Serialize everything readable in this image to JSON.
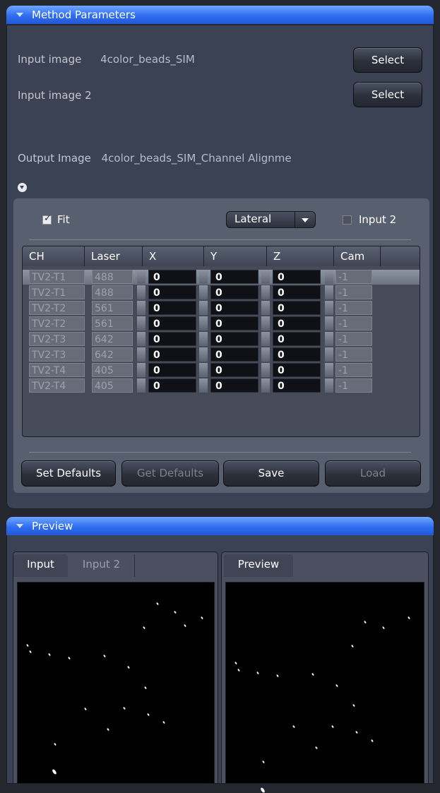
{
  "method_panel": {
    "title": "Method Parameters",
    "input_image_label": "Input image",
    "input_image_value": "4color_beads_SIM",
    "input_image2_label": "Input image 2",
    "select_label": "Select",
    "output_image_label": "Output Image",
    "output_image_value": "4color_beads_SIM_Channel Alignme",
    "fit_label": "Fit",
    "fit_checked": true,
    "mode_value": "Lateral",
    "input2_label": "Input 2",
    "input2_checked": false,
    "columns": [
      "CH",
      "Laser",
      "X",
      "Y",
      "Z",
      "Cam"
    ],
    "rows": [
      {
        "ch": "TV2-T1",
        "laser": "488",
        "x": "0",
        "y": "0",
        "z": "0",
        "cam": "-1"
      },
      {
        "ch": "TV2-T1",
        "laser": "488",
        "x": "0",
        "y": "0",
        "z": "0",
        "cam": "-1"
      },
      {
        "ch": "TV2-T2",
        "laser": "561",
        "x": "0",
        "y": "0",
        "z": "0",
        "cam": "-1"
      },
      {
        "ch": "TV2-T2",
        "laser": "561",
        "x": "0",
        "y": "0",
        "z": "0",
        "cam": "-1"
      },
      {
        "ch": "TV2-T3",
        "laser": "642",
        "x": "0",
        "y": "0",
        "z": "0",
        "cam": "-1"
      },
      {
        "ch": "TV2-T3",
        "laser": "642",
        "x": "0",
        "y": "0",
        "z": "0",
        "cam": "-1"
      },
      {
        "ch": "TV2-T4",
        "laser": "405",
        "x": "0",
        "y": "0",
        "z": "0",
        "cam": "-1"
      },
      {
        "ch": "TV2-T4",
        "laser": "405",
        "x": "0",
        "y": "0",
        "z": "0",
        "cam": "-1"
      }
    ],
    "buttons": {
      "set_defaults": "Set Defaults",
      "get_defaults": "Get Defaults",
      "save": "Save",
      "load": "Load"
    }
  },
  "preview_panel": {
    "title": "Preview",
    "left_tabs": [
      "Input",
      "Input 2"
    ],
    "right_tabs": [
      "Preview"
    ]
  },
  "colors": {
    "header_blue": "#2f6df0",
    "panel_bg": "#3b4253",
    "image_bg": "#000000"
  }
}
